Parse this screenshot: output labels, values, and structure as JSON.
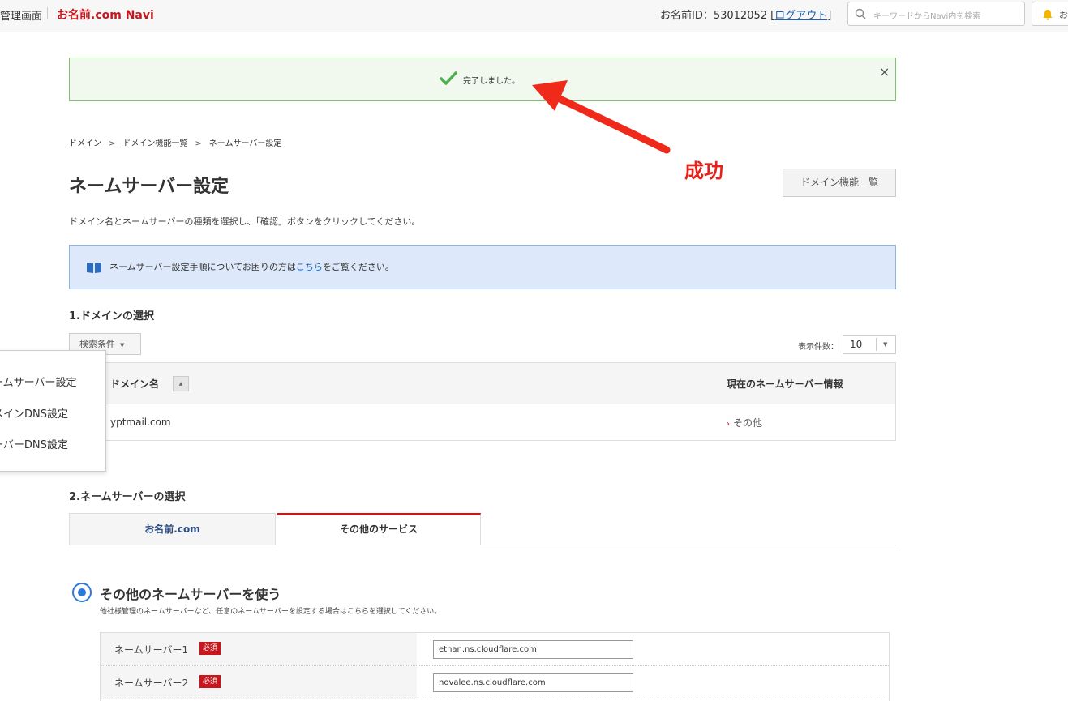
{
  "header": {
    "admin_label": "管理画面",
    "brand": "お名前.com Navi",
    "account_id_label": "お名前ID：53012052",
    "logout_open": "[",
    "logout_label": "ログアウト",
    "logout_close": "]",
    "search_placeholder": "キーワードからNavi内を検索",
    "notice_label": "お"
  },
  "banner": {
    "message": "完了しました。",
    "close": "×"
  },
  "annotation": {
    "text": "成功",
    "color": "#e8201a"
  },
  "breadcrumb": {
    "items": [
      "ドメイン",
      "ドメイン機能一覧",
      "ネームサーバー設定"
    ],
    "separator": ">"
  },
  "page": {
    "title": "ネームサーバー設定",
    "features_button": "ドメイン機能一覧",
    "description": "ドメイン名とネームサーバーの種類を選択し、「確認」ボタンをクリックしてください。",
    "info_before": "ネームサーバー設定手順についてお困りの方は",
    "info_link": "こちら",
    "info_after": "をご覧ください。"
  },
  "section1": {
    "title": "1.ドメインの選択",
    "search_condition": "検索条件",
    "per_page_label": "表示件数：",
    "per_page_value": "10",
    "columns": [
      "ドメイン名",
      "現在のネームサーバー情報"
    ],
    "rows": [
      {
        "domain": "yptmail.com",
        "nameserver": "その他"
      }
    ]
  },
  "menu": {
    "items": [
      "ームサーバー設定",
      "メインDNS設定",
      "ーバーDNS設定"
    ]
  },
  "section2": {
    "title": "2.ネームサーバーの選択",
    "tabs": [
      "お名前.com",
      "その他のサービス"
    ],
    "option_title": "その他のネームサーバーを使う",
    "option_desc": "他社様管理のネームサーバーなど、任意のネームサーバーを設定する場合はこちらを選択してください。",
    "required_label": "必須",
    "nameservers": [
      {
        "label": "ネームサーバー1",
        "value": "ethan.ns.cloudflare.com"
      },
      {
        "label": "ネームサーバー2",
        "value": "novalee.ns.cloudflare.com"
      }
    ]
  },
  "colors": {
    "brand_red": "#c8161d",
    "success_green": "#4caf50",
    "link_blue": "#1f5eb0",
    "radio_blue": "#2d7ad8"
  }
}
